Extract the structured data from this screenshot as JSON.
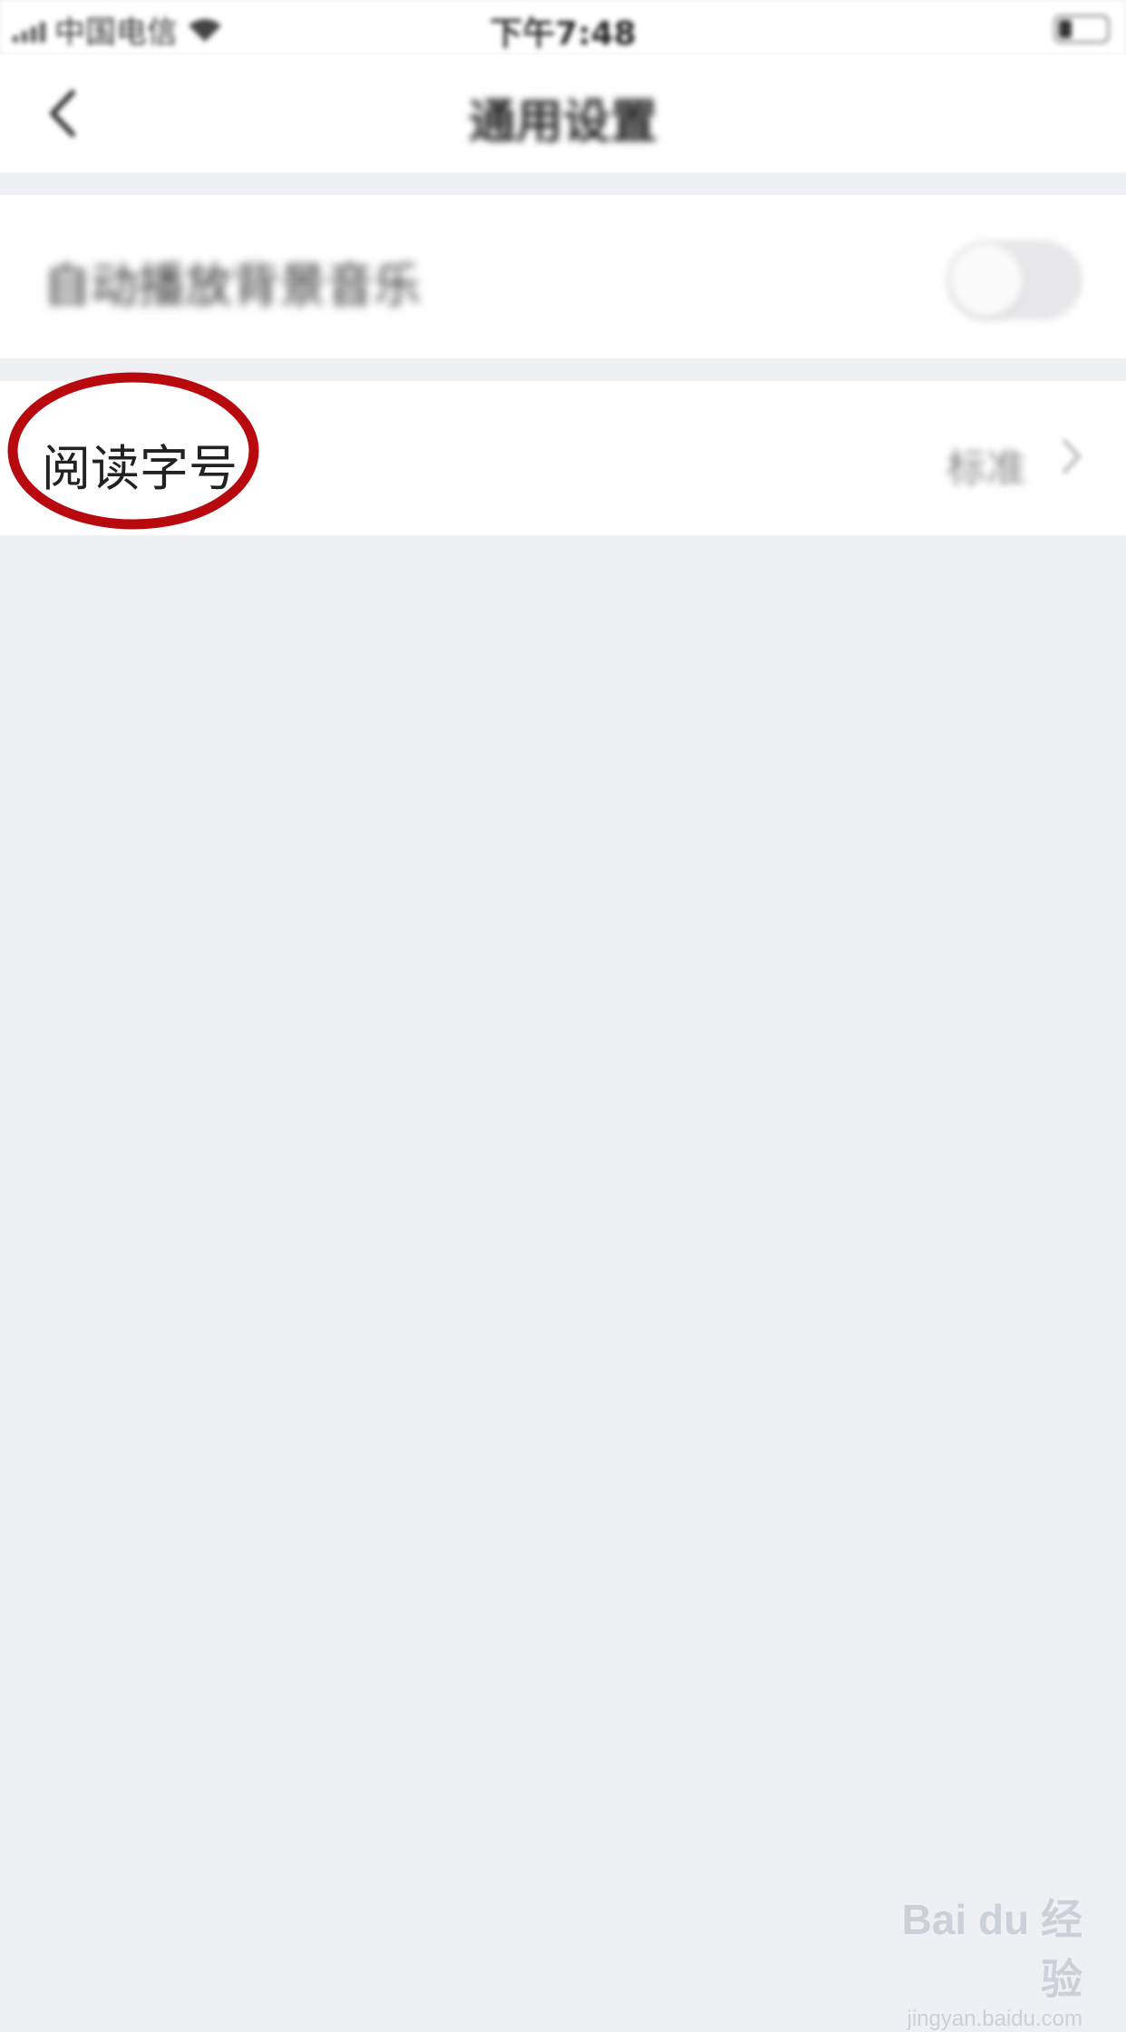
{
  "status_bar": {
    "carrier": "中国电信",
    "time": "下午7:48"
  },
  "nav": {
    "title": "通用设置",
    "back_icon": "chevron-left-icon"
  },
  "settings": {
    "auto_play_music": {
      "label": "自动播放背景音乐",
      "enabled": false
    },
    "reading_font_size": {
      "label": "阅读字号",
      "value": "标准",
      "icon": "chevron-right-icon"
    }
  },
  "annotation": {
    "color": "#b8090f"
  },
  "watermark": {
    "logo": "Bai du 经验",
    "url": "jingyan.baidu.com"
  }
}
